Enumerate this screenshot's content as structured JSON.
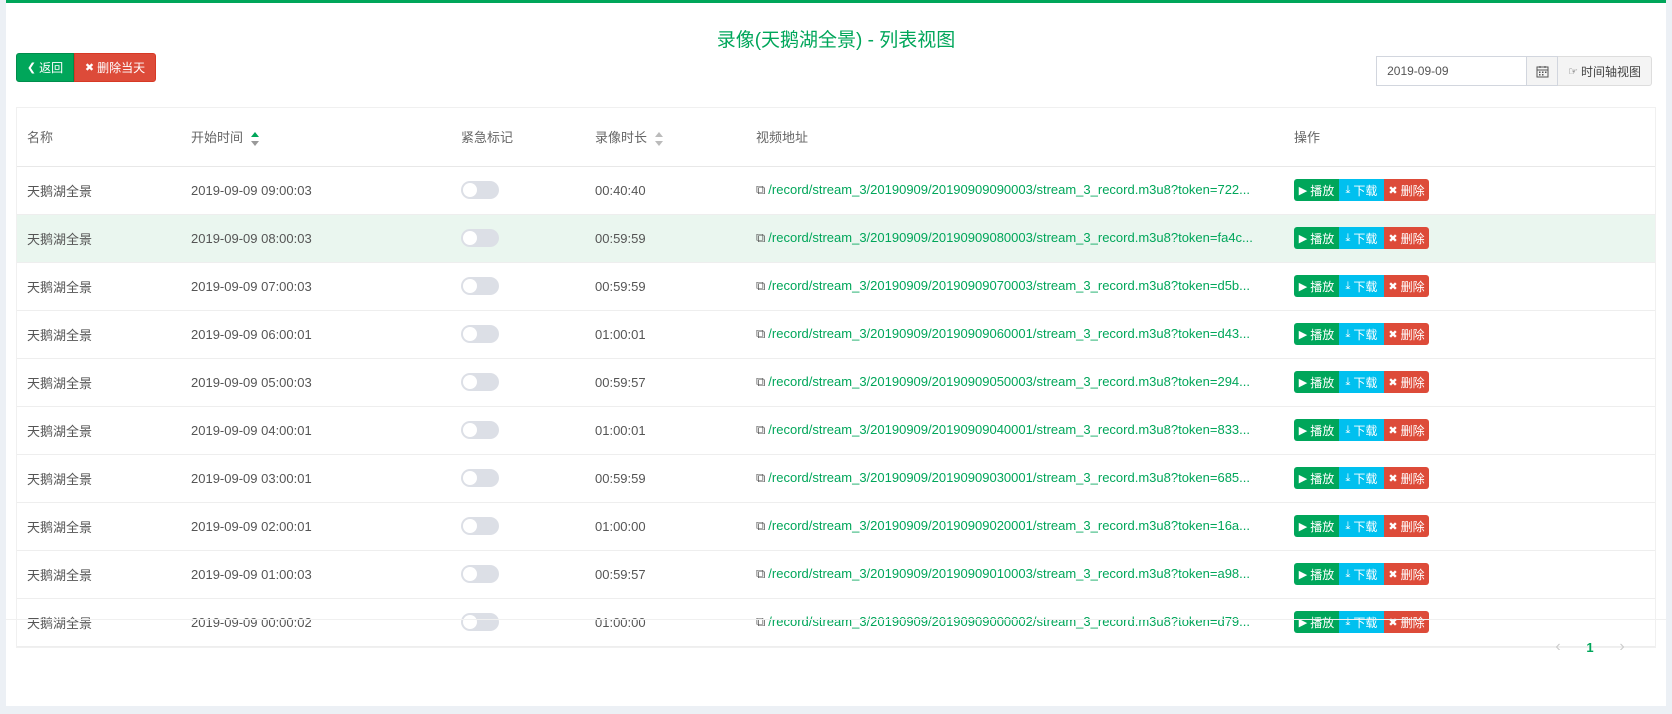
{
  "header": {
    "title": "录像(天鹅湖全景) - 列表视图"
  },
  "toolbar": {
    "back_label": "返回",
    "delete_day_label": "删除当天",
    "date_value": "2019-09-09",
    "timeline_label": "时间轴视图"
  },
  "table": {
    "columns": {
      "name": "名称",
      "start_time": "开始时间",
      "urgent": "紧急标记",
      "duration": "录像时长",
      "url": "视频地址",
      "actions": "操作"
    },
    "action_labels": {
      "play": "播放",
      "download": "下载",
      "delete": "删除"
    },
    "rows": [
      {
        "name": "天鹅湖全景",
        "start_time": "2019-09-09 09:00:03",
        "duration": "00:40:40",
        "url": "/record/stream_3/20190909/20190909090003/stream_3_record.m3u8?token=722..."
      },
      {
        "name": "天鹅湖全景",
        "start_time": "2019-09-09 08:00:03",
        "duration": "00:59:59",
        "url": "/record/stream_3/20190909/20190909080003/stream_3_record.m3u8?token=fa4c..."
      },
      {
        "name": "天鹅湖全景",
        "start_time": "2019-09-09 07:00:03",
        "duration": "00:59:59",
        "url": "/record/stream_3/20190909/20190909070003/stream_3_record.m3u8?token=d5b..."
      },
      {
        "name": "天鹅湖全景",
        "start_time": "2019-09-09 06:00:01",
        "duration": "01:00:01",
        "url": "/record/stream_3/20190909/20190909060001/stream_3_record.m3u8?token=d43..."
      },
      {
        "name": "天鹅湖全景",
        "start_time": "2019-09-09 05:00:03",
        "duration": "00:59:57",
        "url": "/record/stream_3/20190909/20190909050003/stream_3_record.m3u8?token=294..."
      },
      {
        "name": "天鹅湖全景",
        "start_time": "2019-09-09 04:00:01",
        "duration": "01:00:01",
        "url": "/record/stream_3/20190909/20190909040001/stream_3_record.m3u8?token=833..."
      },
      {
        "name": "天鹅湖全景",
        "start_time": "2019-09-09 03:00:01",
        "duration": "00:59:59",
        "url": "/record/stream_3/20190909/20190909030001/stream_3_record.m3u8?token=685..."
      },
      {
        "name": "天鹅湖全景",
        "start_time": "2019-09-09 02:00:01",
        "duration": "01:00:00",
        "url": "/record/stream_3/20190909/20190909020001/stream_3_record.m3u8?token=16a..."
      },
      {
        "name": "天鹅湖全景",
        "start_time": "2019-09-09 01:00:03",
        "duration": "00:59:57",
        "url": "/record/stream_3/20190909/20190909010003/stream_3_record.m3u8?token=a98..."
      },
      {
        "name": "天鹅湖全景",
        "start_time": "2019-09-09 00:00:02",
        "duration": "01:00:00",
        "url": "/record/stream_3/20190909/20190909000002/stream_3_record.m3u8?token=d79..."
      }
    ]
  },
  "pagination": {
    "prev": "‹",
    "current": "1",
    "next": "›"
  },
  "colors": {
    "accent": "#00a65a",
    "danger": "#dd4b39",
    "info": "#00c0ef"
  }
}
